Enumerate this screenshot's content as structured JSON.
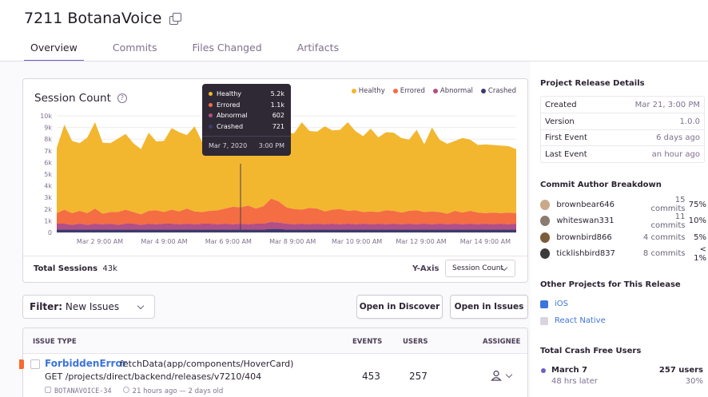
{
  "header": {
    "title": "7211 BotanaVoice"
  },
  "tabs": [
    "Overview",
    "Commits",
    "Files Changed",
    "Artifacts"
  ],
  "chart": {
    "title": "Session Count",
    "legend": [
      {
        "name": "Healthy",
        "color": "#f2b72f"
      },
      {
        "name": "Errored",
        "color": "#f46d43"
      },
      {
        "name": "Abnormal",
        "color": "#b24f86"
      },
      {
        "name": "Crashed",
        "color": "#3d3a6e"
      }
    ],
    "tooltip": {
      "rows": [
        {
          "name": "Healthy",
          "value": "5.2k",
          "color": "#f2b72f"
        },
        {
          "name": "Errored",
          "value": "1.1k",
          "color": "#f46d43"
        },
        {
          "name": "Abnormal",
          "value": "602",
          "color": "#b24f86"
        },
        {
          "name": "Crashed",
          "value": "721",
          "color": "#3d3a6e"
        }
      ],
      "date": "Mar 7, 2020",
      "time": "3:00 PM"
    },
    "total_label": "Total Sessions",
    "total_value": "43k",
    "yaxis_label": "Y-Axis",
    "yaxis_value": "Session Count"
  },
  "chart_data": {
    "type": "area",
    "title": "Session Count",
    "y_ticks": [
      "0",
      "1k",
      "2k",
      "3k",
      "4k",
      "5k",
      "6k",
      "7k",
      "8k",
      "9k",
      "10k"
    ],
    "x_ticks": [
      "Mar 2 9:00 AM",
      "Mar 4 9:00 AM",
      "Mar 6 9:00 AM",
      "Mar 8 9:00 AM",
      "Mar 10 9:00 AM",
      "Mar 12 9:00 AM",
      "Mar 14 9:00 AM"
    ],
    "ylim": [
      0,
      10000
    ],
    "legend_position": "top-right",
    "series": [
      {
        "name": "Healthy",
        "values": [
          5600,
          7300,
          6200,
          5800,
          6500,
          7400,
          6100,
          5900,
          6300,
          6500,
          5900,
          5600,
          6700,
          5900,
          6100,
          7000,
          6800,
          6300,
          7300,
          6000,
          6000,
          6400,
          6500,
          6800,
          6300,
          6700,
          6800,
          6200,
          6700,
          6300,
          6400,
          6500,
          7500,
          6600,
          6600,
          7300,
          6800,
          6800,
          7600,
          6800,
          6500,
          7100,
          6400,
          6700,
          6700,
          6400,
          6100,
          6900,
          5800,
          7200,
          6200,
          6000,
          6000,
          6400,
          6100,
          5800,
          5900,
          5800,
          5800,
          5700,
          5500
        ]
      },
      {
        "name": "Errored",
        "values": [
          900,
          1200,
          1000,
          1100,
          1000,
          1300,
          900,
          1000,
          1100,
          1200,
          1000,
          900,
          1100,
          1200,
          1000,
          1200,
          1100,
          1300,
          1100,
          1000,
          1100,
          1200,
          1300,
          1500,
          1400,
          1600,
          1300,
          1500,
          2000,
          1800,
          1400,
          1300,
          1200,
          1400,
          1300,
          1100,
          1200,
          1300,
          1100,
          1200,
          1000,
          1100,
          1000,
          1200,
          1100,
          1000,
          1100,
          1200,
          1000,
          1100,
          1000,
          900,
          1100,
          1000,
          1100,
          1000,
          900,
          1000,
          900,
          1000,
          900
        ]
      },
      {
        "name": "Abnormal",
        "values": [
          500,
          500,
          400,
          500,
          400,
          500,
          450,
          500,
          400,
          500,
          500,
          400,
          500,
          450,
          500,
          500,
          450,
          500,
          450,
          500,
          500,
          450,
          500,
          450,
          500,
          450,
          500,
          500,
          600,
          550,
          500,
          450,
          500,
          450,
          500,
          450,
          500,
          450,
          500,
          450,
          500,
          450,
          500,
          450,
          500,
          450,
          500,
          450,
          500,
          450,
          500,
          450,
          500,
          450,
          500,
          450,
          500,
          450,
          500,
          450,
          500
        ]
      },
      {
        "name": "Crashed",
        "values": [
          250,
          250,
          250,
          250,
          250,
          250,
          250,
          250,
          250,
          250,
          250,
          250,
          250,
          250,
          250,
          250,
          250,
          250,
          250,
          250,
          250,
          250,
          250,
          250,
          250,
          250,
          250,
          250,
          300,
          300,
          250,
          250,
          250,
          250,
          250,
          250,
          250,
          250,
          250,
          250,
          250,
          250,
          250,
          250,
          250,
          250,
          250,
          250,
          250,
          250,
          250,
          250,
          250,
          250,
          250,
          250,
          250,
          250,
          250,
          250,
          250
        ]
      }
    ]
  },
  "filters": {
    "filter_label": "Filter:",
    "filter_value": "New Issues",
    "discover_button": "Open in Discover",
    "issues_button": "Open in Issues"
  },
  "issues_table": {
    "headers": {
      "type": "ISSUE TYPE",
      "events": "EVENTS",
      "users": "USERS",
      "assignee": "ASSIGNEE"
    },
    "rows": [
      {
        "error_type": "ForbiddenError",
        "function": "fetchData(app/components/HoverCard)",
        "message": "GET /projects/direct/backend/releases/v7210/404",
        "short_id": "BOTANAVOICE-34",
        "time": "21 hours ago — 2 days old",
        "events": "453",
        "users": "257"
      }
    ]
  },
  "sidebar": {
    "release_details_title": "Project Release Details",
    "release_details": [
      {
        "key": "Created",
        "value": "Mar 21, 3:00 PM"
      },
      {
        "key": "Version",
        "value": "1.0.0"
      },
      {
        "key": "First Event",
        "value": "6 days ago"
      },
      {
        "key": "Last Event",
        "value": "an hour ago"
      }
    ],
    "authors_title": "Commit Author Breakdown",
    "authors": [
      {
        "name": "brownbear646",
        "commits": "15 commits",
        "percent": "75%",
        "color": "#c9a98a"
      },
      {
        "name": "whiteswan331",
        "commits": "11 commits",
        "percent": "10%",
        "color": "#8a7c6e"
      },
      {
        "name": "brownbird866",
        "commits": "4 commits",
        "percent": "5%",
        "color": "#7b5d3c"
      },
      {
        "name": "ticklishbird837",
        "commits": "8 commits",
        "percent": "< 1%",
        "color": "#3b3b3b"
      }
    ],
    "other_projects_title": "Other Projects for This Release",
    "other_projects": [
      {
        "name": "iOS",
        "icon_color": "#3d74db",
        "icon": "ios-icon"
      },
      {
        "name": "React Native",
        "icon_color": "#b7b0bf",
        "icon": "react-native-icon"
      }
    ],
    "crash_free_title": "Total Crash Free Users",
    "crash_free": [
      {
        "date": "March 7",
        "sub": "48 hrs later",
        "users": "257 users",
        "pct": "30%"
      }
    ]
  }
}
